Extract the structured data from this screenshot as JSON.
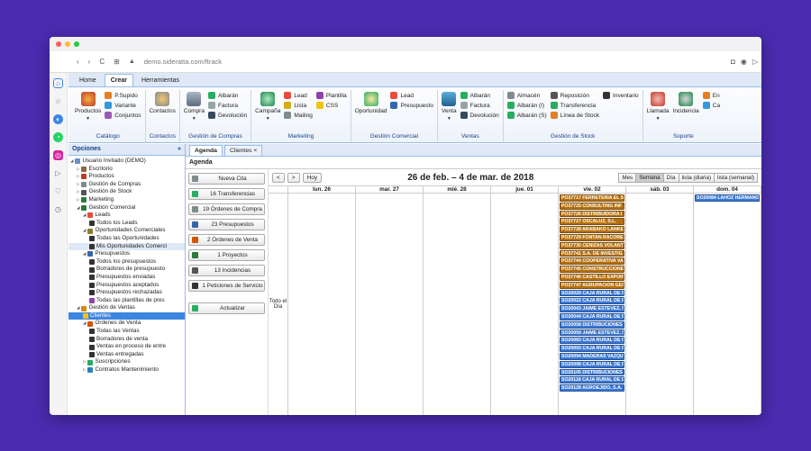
{
  "browser": {
    "url": "demo.sideratta.com/ftrack",
    "nav_back": "‹",
    "nav_forward": "›",
    "reload": "C",
    "grid": "⊞",
    "warning": "▲",
    "right_icons": [
      "◘",
      "◉",
      "▷"
    ]
  },
  "ribbon_tabs": [
    "Home",
    "Crear",
    "Herramientas"
  ],
  "ribbon": {
    "catalogo": {
      "title": "Catálogo",
      "big": "Productos",
      "items": [
        "P.Supido",
        "Variante",
        "Conjuntos"
      ]
    },
    "contactos": {
      "title": "Contactos",
      "big": "Contactos"
    },
    "compras": {
      "title": "Gestión de Compras",
      "big": "Compra",
      "items": [
        "Albarán",
        "Factura",
        "Devolución"
      ]
    },
    "marketing": {
      "title": "Marketing",
      "big": "Campaña",
      "col1": [
        "Lead",
        "Lista",
        "Mailing"
      ],
      "col2": [
        "Plantilla",
        "CSS"
      ]
    },
    "comercial": {
      "title": "Gestión Comercial",
      "big": "Oportunidad",
      "items": [
        "Lead",
        "Presupuesto"
      ]
    },
    "ventas": {
      "title": "Ventas",
      "big": "Venta",
      "items": [
        "Albarán",
        "Factura",
        "Devolución"
      ]
    },
    "stock": {
      "title": "Gestión de Stock",
      "col1": [
        "Almacén",
        "Albarán (I)",
        "Albarán (S)"
      ],
      "col2": [
        "Reposición",
        "Transferencia",
        "Línea de Stock"
      ],
      "col3": [
        "Inventario"
      ]
    },
    "soporte": {
      "title": "Soporte",
      "items": [
        "Llamada",
        "Incidencia"
      ],
      "cut1": "En",
      "cut2": "Ca"
    }
  },
  "left": {
    "title": "Opciones",
    "collapse": "«",
    "tree": [
      {
        "label": "Usuario Invitado (DEMO)",
        "indent": 0,
        "prefix": "◢",
        "color": "#6a8fc7"
      },
      {
        "label": "Escritorio",
        "indent": 1,
        "prefix": "▷",
        "color": "#8a6a3a"
      },
      {
        "label": "Productos",
        "indent": 1,
        "prefix": "▷",
        "color": "#c0392b"
      },
      {
        "label": "Gestión de Compras",
        "indent": 1,
        "prefix": "▷",
        "color": "#7f8c8d"
      },
      {
        "label": "Gestión de Stock",
        "indent": 1,
        "prefix": "▷",
        "color": "#555"
      },
      {
        "label": "Marketing",
        "indent": 1,
        "prefix": "▷",
        "color": "#2c7a3b"
      },
      {
        "label": "Gestión Comercial",
        "indent": 1,
        "prefix": "◢",
        "color": "#2c7a3b"
      },
      {
        "label": "Leads",
        "indent": 2,
        "prefix": "◢",
        "color": "#e74c3c"
      },
      {
        "label": "Todos los Leads",
        "indent": 3,
        "prefix": "",
        "color": "#333"
      },
      {
        "label": "Oportunidades Comerciales",
        "indent": 2,
        "prefix": "◢",
        "color": "#8e7c2c"
      },
      {
        "label": "Todas las Oportunidades",
        "indent": 3,
        "prefix": "",
        "color": "#333"
      },
      {
        "label": "Mis Oportunidades Comerci",
        "indent": 3,
        "prefix": "",
        "color": "#333",
        "hl": true
      },
      {
        "label": "Presupuestos",
        "indent": 2,
        "prefix": "◢",
        "color": "#3366aa"
      },
      {
        "label": "Todos los presupuestos",
        "indent": 3,
        "prefix": "",
        "color": "#333"
      },
      {
        "label": "Borradores de presupuesto",
        "indent": 3,
        "prefix": "",
        "color": "#333"
      },
      {
        "label": "Presupuestos enviadas",
        "indent": 3,
        "prefix": "",
        "color": "#333"
      },
      {
        "label": "Presupuestos aceptados",
        "indent": 3,
        "prefix": "",
        "color": "#333"
      },
      {
        "label": "Presupuestos rechazadas",
        "indent": 3,
        "prefix": "",
        "color": "#333"
      },
      {
        "label": "Todas las plantillas de pres",
        "indent": 3,
        "prefix": "",
        "color": "#8e44ad"
      },
      {
        "label": "Gestión de Ventas",
        "indent": 1,
        "prefix": "◢",
        "color": "#d68910"
      },
      {
        "label": "Clientes",
        "indent": 2,
        "prefix": "",
        "color": "#f1c40f",
        "sel": true
      },
      {
        "label": "Órdenes de Venta",
        "indent": 2,
        "prefix": "◢",
        "color": "#d35400"
      },
      {
        "label": "Todas las Ventas",
        "indent": 3,
        "prefix": "",
        "color": "#333"
      },
      {
        "label": "Borradores de venta",
        "indent": 3,
        "prefix": "",
        "color": "#333"
      },
      {
        "label": "Ventas en proceso de entre",
        "indent": 3,
        "prefix": "",
        "color": "#333"
      },
      {
        "label": "Ventas entregadas",
        "indent": 3,
        "prefix": "",
        "color": "#333"
      },
      {
        "label": "Suscripciones",
        "indent": 2,
        "prefix": "▷",
        "color": "#27ae60"
      },
      {
        "label": "Contratos Mantenimiento",
        "indent": 2,
        "prefix": "▷",
        "color": "#2980b9"
      }
    ]
  },
  "tabs": [
    "Agenda",
    "Clientes ×"
  ],
  "agenda": {
    "title": "Agenda",
    "actions": [
      {
        "label": "Nueva Cita",
        "color": "#7f8c8d"
      },
      {
        "label": "16 Transferencias",
        "color": "#27ae60"
      },
      {
        "label": "19 Órdenes de Compra",
        "color": "#7f8c8d"
      },
      {
        "label": "23 Presupuestos",
        "color": "#3366aa"
      },
      {
        "label": "2 Órdenes de Venta",
        "color": "#d35400"
      },
      {
        "label": "1 Proyectos",
        "color": "#2c7a3b"
      },
      {
        "label": "13 Incidencias",
        "color": "#555"
      },
      {
        "label": "1 Peticiones de Servicio",
        "color": "#333"
      },
      {
        "label": "Actualizar",
        "color": "#27ae60"
      }
    ],
    "nav_prev": "<",
    "nav_next": ">",
    "today": "Hoy",
    "range_title": "26 de feb. – 4 de mar. de 2018",
    "views": [
      "Mes",
      "Semana",
      "Día",
      "lista (diaria)",
      "lista (semanal)"
    ],
    "active_view": "Semana",
    "allday_label": "Todo el Día",
    "days": [
      {
        "label": "lun. 26",
        "events": []
      },
      {
        "label": "mar. 27",
        "events": []
      },
      {
        "label": "mié. 28",
        "events": []
      },
      {
        "label": "jue. 01",
        "events": []
      },
      {
        "label": "vie. 02",
        "events": [
          {
            "t": "PO37717 FERRETERIA EL ST",
            "c": "orange"
          },
          {
            "t": "PO37725 CONSULTING INF",
            "c": "orange"
          },
          {
            "t": "PO37726 DISTRIBUIDORA I",
            "c": "orange"
          },
          {
            "t": "PO37727 OSCALUZ, S.L.",
            "c": "orange"
          },
          {
            "t": "PO37728 ARABAKO LANKET",
            "c": "orange"
          },
          {
            "t": "PO37729 FONTAN RACORER",
            "c": "orange"
          },
          {
            "t": "PO37730 CENIZAS VOLANTI",
            "c": "orange"
          },
          {
            "t": "PO37741 S.A. DE INVESTIG",
            "c": "orange"
          },
          {
            "t": "PO37744 COOPERATIVA VAI",
            "c": "orange"
          },
          {
            "t": "PO37745 CONSTRUCCIONE",
            "c": "orange"
          },
          {
            "t": "PO37746 CASTILLO EXPORT",
            "c": "orange"
          },
          {
            "t": "PO37747 AGRUPACION GES",
            "c": "orange"
          },
          {
            "t": "SO20020 CAJA RURAL DE S",
            "c": "blue"
          },
          {
            "t": "SO20022 CAJA RURAL DE S",
            "c": "blue"
          },
          {
            "t": "SO20043 JAIME ESTEVEZ, S",
            "c": "blue"
          },
          {
            "t": "SO20044 CAJA RURAL DE S",
            "c": "blue"
          },
          {
            "t": "SO20058 DISTRIBUCIONES",
            "c": "blue"
          },
          {
            "t": "SO20059 JAIME ESTEVEZ, S",
            "c": "blue"
          },
          {
            "t": "SO20083 CAJA RURAL DE S",
            "c": "blue"
          },
          {
            "t": "SO20093 CAJA RURAL DE S",
            "c": "blue"
          },
          {
            "t": "SO20094 MADERAS VAZQUE",
            "c": "blue"
          },
          {
            "t": "SO20098 CAJA RURAL DE S",
            "c": "blue"
          },
          {
            "t": "SO20105 DISTRIBUCIONES",
            "c": "blue"
          },
          {
            "t": "SO20118 CAJA RURAL DE S",
            "c": "blue"
          },
          {
            "t": "SO20128 AGROEJIDO, S.A.",
            "c": "blue"
          }
        ]
      },
      {
        "label": "sáb. 03",
        "events": []
      },
      {
        "label": "dom. 04",
        "events": [
          {
            "t": "SO20084 LAHOZ HERMANOS",
            "c": "blue"
          }
        ]
      }
    ]
  },
  "colors": {
    "accent": "#3d86e0",
    "ribbon_border": "#99bbe8",
    "background": "#4b2bb0"
  }
}
